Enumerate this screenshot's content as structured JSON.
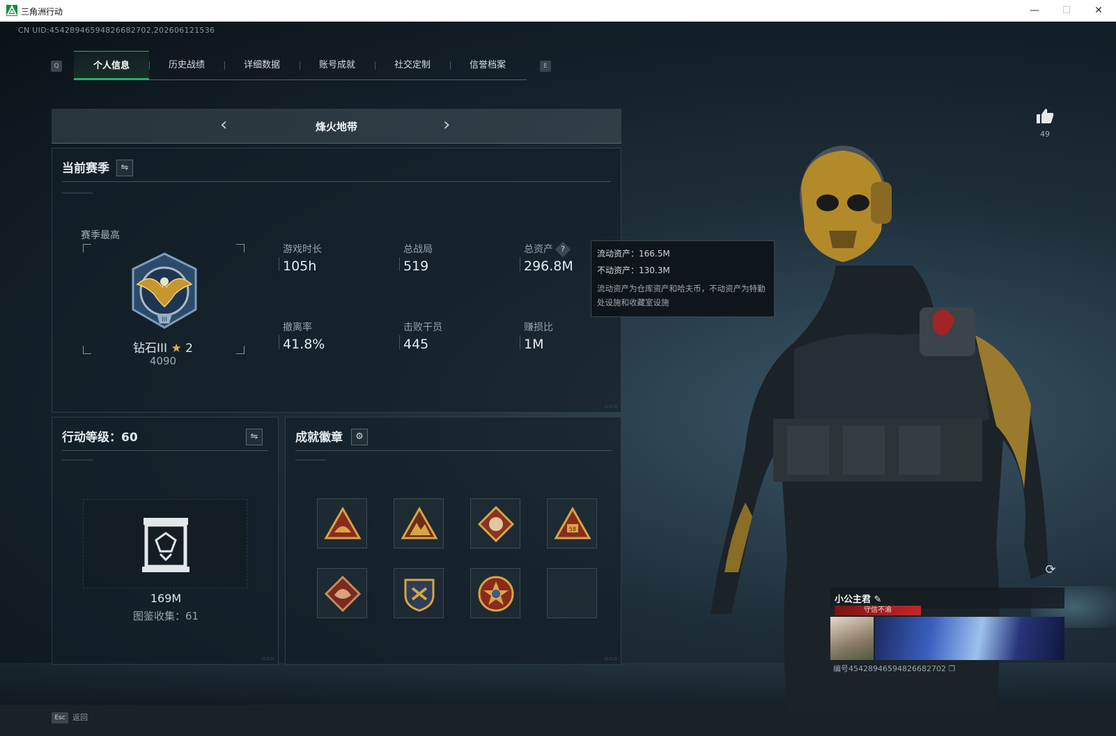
{
  "window": {
    "title": "三角洲行动",
    "minimize": "—",
    "maximize": "☐",
    "close": "✕"
  },
  "uid_line": "CN UID:4542894659482668270​2,202606121536",
  "tabs": {
    "left_key": "Q",
    "right_key": "E",
    "items": [
      {
        "label": "个人信息",
        "active": true
      },
      {
        "label": "历史战绩",
        "active": false
      },
      {
        "label": "详细数据",
        "active": false
      },
      {
        "label": "账号成就",
        "active": false
      },
      {
        "label": "社交定制",
        "active": false
      },
      {
        "label": "信誉档案",
        "active": false
      }
    ]
  },
  "mode": {
    "name": "烽火地带",
    "prev": "‹",
    "next": "›"
  },
  "season": {
    "title": "当前赛季",
    "peak_label": "赛季最高",
    "rank_name": "钻石III",
    "rank_stars": "2",
    "rank_score": "4090",
    "stats": [
      {
        "label": "游戏时长",
        "value": "105h"
      },
      {
        "label": "总战局",
        "value": "519"
      },
      {
        "label": "总资产",
        "value": "296.8M"
      },
      {
        "label": "撤离率",
        "value": "41.8%"
      },
      {
        "label": "击败干员",
        "value": "445"
      },
      {
        "label": "赚损比",
        "value": "1M"
      }
    ],
    "help_icon": "?"
  },
  "tooltip": {
    "liquid": "流动资产：166.5M",
    "fixed": "不动资产：130.3M",
    "desc": "流动资产为仓库资产和哈夫币，不动资产为特勤处设施和收藏室设施"
  },
  "level": {
    "title": "行动等级：60",
    "money": "169M",
    "collection": "图鉴收集：61"
  },
  "badges": {
    "title": "成就徽章",
    "items": [
      "triangle-badge-1",
      "triangle-badge-2",
      "diamond-wolf-badge",
      "triangle-58-badge",
      "diamond-dragon-badge",
      "shield-badge",
      "star-medal-badge",
      "empty-slot"
    ]
  },
  "likes": {
    "count": "49"
  },
  "namecard": {
    "name": "小公主君",
    "title": "守信不渝",
    "code": "编号4542894659482668270​2"
  },
  "esc": {
    "key": "Esc",
    "label": "返回"
  },
  "colors": {
    "accent": "#1fb36b",
    "badge_gold": "#c8962e",
    "badge_red": "#8a2a1e"
  }
}
